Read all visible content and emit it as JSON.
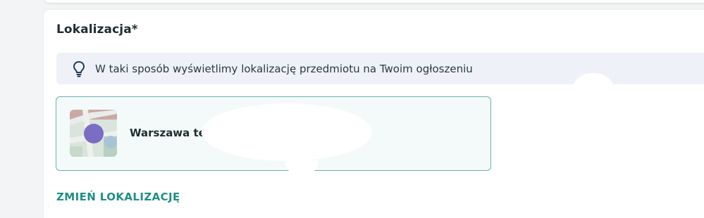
{
  "section": {
    "title": "Lokalizacja*",
    "info_banner": {
      "icon": "lightbulb-icon",
      "text": "W taki sposób wyświetlimy lokalizację przedmiotu na Twoim ogłoszeniu"
    },
    "location_card": {
      "map_icon": "map-thumbnail",
      "name": "Warszawa tel"
    },
    "change_link": "ZMIEŃ LOKALIZACJĘ"
  },
  "colors": {
    "accent": "#1e8f87",
    "card_border": "#6bb1ad",
    "card_bg": "#f3faf9",
    "banner_bg": "#eef2f8",
    "pin": "#7b6cc4"
  }
}
